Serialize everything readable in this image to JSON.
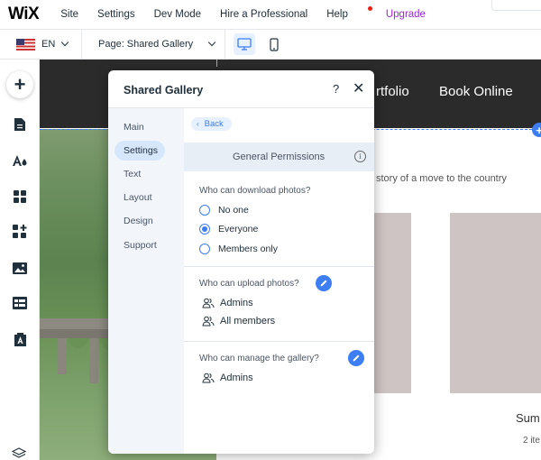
{
  "topbar": {
    "logo": "WiX",
    "menu": [
      "Site",
      "Settings",
      "Dev Mode",
      "Hire a Professional",
      "Help",
      "Upgrade"
    ]
  },
  "subbar": {
    "language": "EN",
    "page_selector": "Page: Shared Gallery",
    "devices": [
      "desktop-icon",
      "mobile-icon"
    ]
  },
  "lefttools": [
    "add-icon",
    "pages-icon",
    "theme-icon",
    "apps-grid-icon",
    "add-apps-icon",
    "media-icon",
    "table-icon",
    "portfolio-icon",
    "layers-icon"
  ],
  "canvas": {
    "nav": [
      "rtfolio",
      "Book Online"
    ],
    "story_text": "story of a move to the country",
    "gallery_title_partial": "Sum",
    "gallery_count_partial": "2 ite"
  },
  "panel": {
    "title": "Shared Gallery",
    "help": "?",
    "close": "✕",
    "tabs": [
      "Main",
      "Settings",
      "Text",
      "Layout",
      "Design",
      "Support"
    ],
    "active_tab": "Settings",
    "back": "Back",
    "section_title": "General Permissions",
    "download": {
      "question": "Who can download photos?",
      "options": [
        "No one",
        "Everyone",
        "Members only"
      ],
      "selected": "Everyone"
    },
    "upload": {
      "question": "Who can upload photos?",
      "roles": [
        "Admins",
        "All members"
      ]
    },
    "manage": {
      "question": "Who can manage the gallery?",
      "roles": [
        "Admins"
      ]
    }
  },
  "colors": {
    "accent": "#3d7ef5",
    "upgrade": "#9a27d5",
    "header_dark": "#2b2b2b"
  }
}
